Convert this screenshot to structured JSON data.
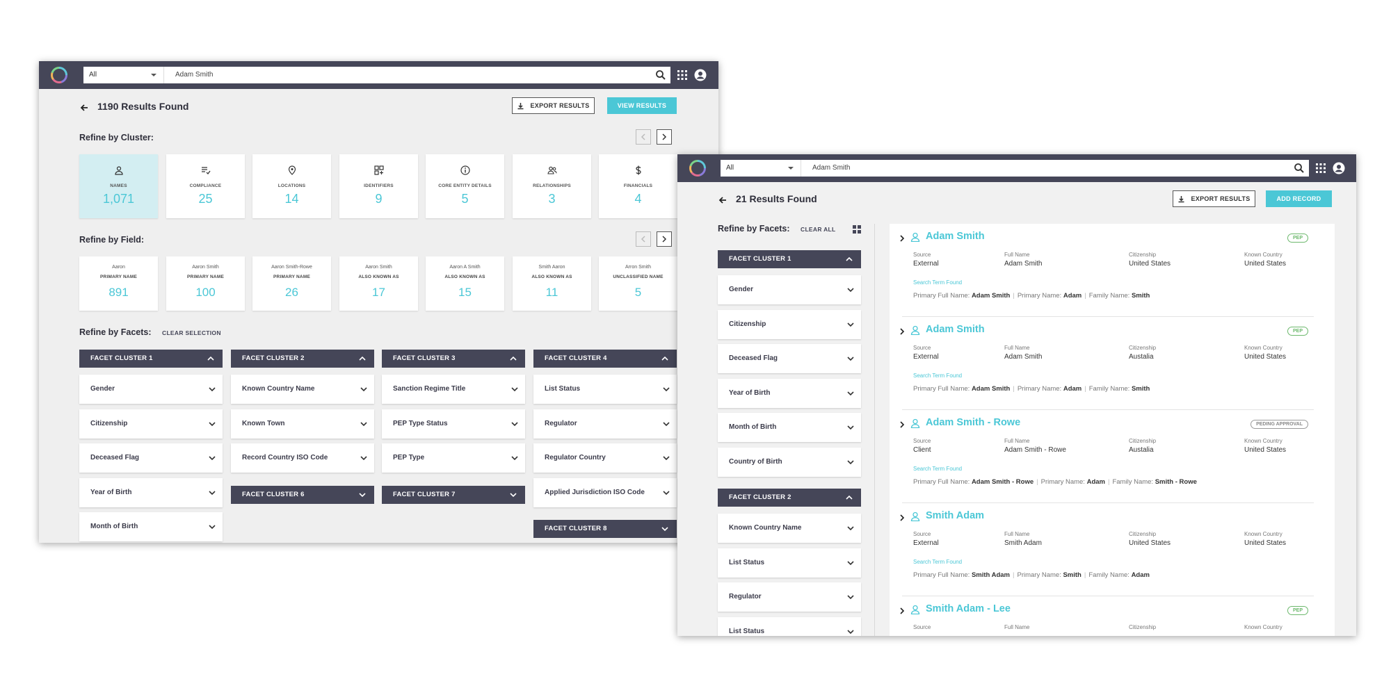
{
  "window1": {
    "topbar": {
      "scope": "All",
      "search_value": "Adam Smith"
    },
    "results_title": "1190 Results Found",
    "export_label": "EXPORT RESULTS",
    "view_label": "VIEW RESULTS",
    "cluster_section": "Refine by Cluster:",
    "clusters": [
      {
        "label": "NAMES",
        "count": "1,071",
        "icon": "user-icon"
      },
      {
        "label": "COMPLIANCE",
        "count": "25",
        "icon": "list-check-icon"
      },
      {
        "label": "LOCATIONS",
        "count": "14",
        "icon": "location-pin-icon"
      },
      {
        "label": "IDENTIFIERS",
        "count": "9",
        "icon": "grid-icon"
      },
      {
        "label": "CORE ENTITY DETAILS",
        "count": "5",
        "icon": "info-icon"
      },
      {
        "label": "RELATIONSHIPS",
        "count": "3",
        "icon": "people-icon"
      },
      {
        "label": "FINANCIALS",
        "count": "4",
        "icon": "dollar-icon"
      }
    ],
    "field_section": "Refine by Field:",
    "fields": [
      {
        "name": "Aaron",
        "type": "PRIMARY NAME",
        "count": "891"
      },
      {
        "name": "Aaron Smith",
        "type": "PRIMARY NAME",
        "count": "100"
      },
      {
        "name": "Aaron Smith-Rowe",
        "type": "PRIMARY NAME",
        "count": "26"
      },
      {
        "name": "Aaron Smith",
        "type": "ALSO KNOWN AS",
        "count": "17"
      },
      {
        "name": "Aaron A Smith",
        "type": "ALSO KNOWN AS",
        "count": "15"
      },
      {
        "name": "Smith Aaron",
        "type": "ALSO KNOWN AS",
        "count": "11"
      },
      {
        "name": "Arron Smith",
        "type": "UNCLASSIFIED NAME",
        "count": "5"
      }
    ],
    "facets_section": "Refine by Facets:",
    "clear_selection": "CLEAR SELECTION",
    "facet_columns": [
      {
        "header": "FACET CLUSTER 1",
        "items": [
          "Gender",
          "Citizenship",
          "Deceased Flag",
          "Year of Birth",
          "Month of Birth"
        ]
      },
      {
        "header": "FACET CLUSTER 2",
        "items": [
          "Known Country Name",
          "Known Town",
          "Record Country ISO Code"
        ],
        "extra": "FACET CLUSTER 6"
      },
      {
        "header": "FACET CLUSTER 3",
        "items": [
          "Sanction Regime Title",
          "PEP Type Status",
          "PEP Type"
        ],
        "extra": "FACET CLUSTER 7"
      },
      {
        "header": "FACET CLUSTER 4",
        "items": [
          "List Status",
          "Regulator",
          "Regulator Country",
          "Applied Jurisdiction ISO Code"
        ],
        "extra": "FACET CLUSTER 8"
      }
    ]
  },
  "window2": {
    "topbar": {
      "scope": "All",
      "search_value": "Adam Smith"
    },
    "results_title": "21 Results Found",
    "export_label": "EXPORT RESULTS",
    "add_label": "ADD RECORD",
    "facets_section": "Refine by Facets:",
    "clear_all": "CLEAR ALL",
    "cluster1": {
      "header": "FACET CLUSTER 1",
      "items": [
        "Gender",
        "Citizenship",
        "Deceased Flag",
        "Year of Birth",
        "Month of Birth",
        "Country of Birth"
      ]
    },
    "cluster2": {
      "header": "FACET CLUSTER 2",
      "items": [
        "Known Country Name",
        "List Status",
        "Regulator",
        "List Status"
      ]
    },
    "col_labels": {
      "source": "Source",
      "full_name": "Full Name",
      "citizenship": "Citizenship",
      "known_country": "Known Country"
    },
    "search_term_found": "Search Term Found",
    "term_labels": {
      "primary_full": "Primary Full Name:",
      "primary": "Primary Name:",
      "family": "Family Name:"
    },
    "results": [
      {
        "name": "Adam Smith",
        "badge": "PEP",
        "source": "External",
        "full_name": "Adam Smith",
        "citizenship": "United States",
        "known_country": "United States",
        "primary_full": "Adam Smith",
        "primary": "Adam",
        "family": "Smith"
      },
      {
        "name": "Adam Smith",
        "badge": "PEP",
        "source": "External",
        "full_name": "Adam Smith",
        "citizenship": "Austalia",
        "known_country": "United States",
        "primary_full": "Adam Smith",
        "primary": "Adam",
        "family": "Smith"
      },
      {
        "name": "Adam Smith - Rowe",
        "badge": "PEDING APPROVAL",
        "source": "Client",
        "full_name": "Adam Smith - Rowe",
        "citizenship": "Austalia",
        "known_country": "United States",
        "primary_full": "Adam Smith - Rowe",
        "primary": "Adam",
        "family": "Smith - Rowe"
      },
      {
        "name": "Smith Adam",
        "badge": "",
        "source": "External",
        "full_name": "Smith Adam",
        "citizenship": "United States",
        "known_country": "United States",
        "primary_full": "Smith Adam",
        "primary": "Smith",
        "family": "Adam"
      },
      {
        "name": "Smith Adam - Lee",
        "badge": "PEP",
        "source": "",
        "full_name": "",
        "citizenship": "",
        "known_country": "",
        "primary_full": "",
        "primary": "",
        "family": ""
      }
    ]
  },
  "colors": {
    "topbar": "#454658",
    "accent": "#4bc7d6",
    "pep": "#6cb86c",
    "selected_card": "#d3eef2"
  }
}
